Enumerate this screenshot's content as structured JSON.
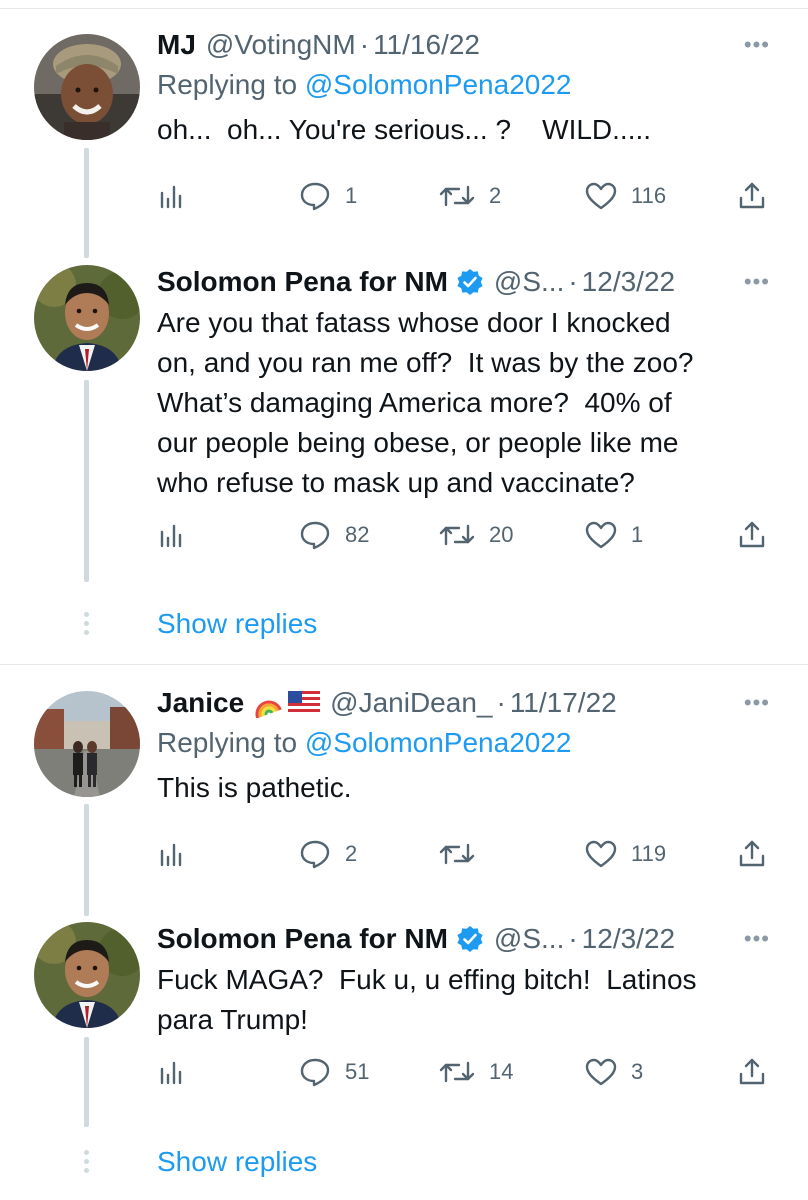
{
  "tweets": [
    {
      "name": "MJ",
      "handle": "@VotingNM",
      "date": "11/16/22",
      "replying_prefix": "Replying to ",
      "replying_to": "@SolomonPena2022",
      "text": "oh...  oh... You're serious... ?    WILD.....",
      "stats": {
        "replies": "1",
        "retweets": "2",
        "likes": "116"
      }
    },
    {
      "name": "Solomon Pena for NM",
      "handle": "@S...",
      "date": "12/3/22",
      "text": "Are you that fatass whose door I knocked\non, and you ran me off?  It was by the zoo?\nWhat’s damaging America more?  40% of\nour people being obese, or people like me\nwho refuse to mask up and vaccinate?",
      "stats": {
        "replies": "82",
        "retweets": "20",
        "likes": "1"
      }
    },
    {
      "name": "Janice",
      "handle": "@JaniDean_",
      "date": "11/17/22",
      "replying_prefix": "Replying to ",
      "replying_to": "@SolomonPena2022",
      "text": "This is pathetic.",
      "stats": {
        "replies": "2",
        "retweets": "",
        "likes": "119"
      }
    },
    {
      "name": "Solomon Pena for NM",
      "handle": "@S...",
      "date": "12/3/22",
      "text": "Fuck MAGA?  Fuk u, u effing bitch!  Latinos\npara Trump!",
      "stats": {
        "replies": "51",
        "retweets": "14",
        "likes": "3"
      }
    }
  ],
  "sep": "·",
  "more": "•••",
  "show_replies": "Show replies",
  "colors": {
    "link": "#1d9bf0",
    "muted": "#536471",
    "text": "#0f1419",
    "verified": "#1d9bf0",
    "line": "#cfd9de"
  },
  "icons": [
    "views-icon",
    "reply-icon",
    "retweet-icon",
    "like-icon",
    "share-icon",
    "verified-badge-icon",
    "rainbow-emoji",
    "us-flag-emoji"
  ]
}
